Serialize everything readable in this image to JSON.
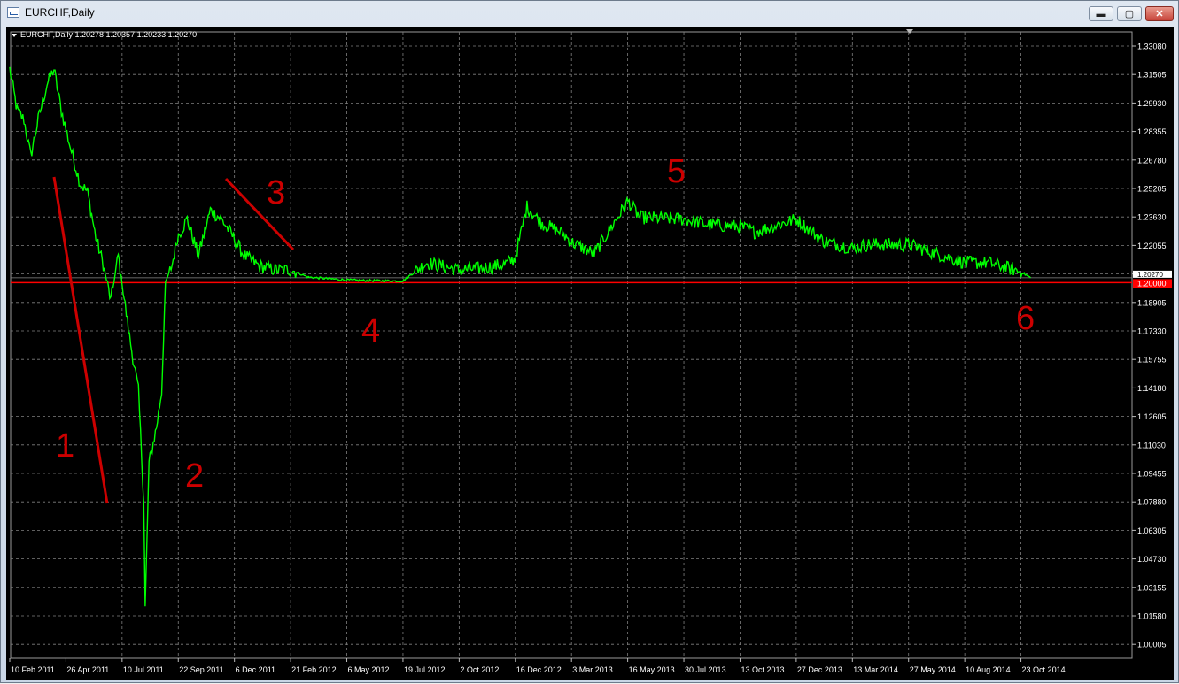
{
  "window": {
    "title": "EURCHF,Daily",
    "controls": {
      "minimize": "▬",
      "maximize": "▢",
      "close": "✕"
    }
  },
  "chart": {
    "info_line": "EURCHF,Daily  1.20278 1.20357 1.20233 1.20270",
    "price_scale": [
      "1.33080",
      "1.31505",
      "1.29930",
      "1.28355",
      "1.26780",
      "1.25205",
      "1.23630",
      "1.22055",
      "1.20270",
      "1.18905",
      "1.17330",
      "1.15755",
      "1.14180",
      "1.12605",
      "1.11030",
      "1.09455",
      "1.07880",
      "1.06305",
      "1.04730",
      "1.03155",
      "1.01580",
      "1.00005"
    ],
    "current_price_label": "1.20270",
    "level_label": "1.20000",
    "time_scale": [
      "10 Feb 2011",
      "26 Apr 2011",
      "10 Jul 2011",
      "22 Sep 2011",
      "6 Dec 2011",
      "21 Feb 2012",
      "6 May 2012",
      "19 Jul 2012",
      "2 Oct 2012",
      "16 Dec 2012",
      "3 Mar 2013",
      "16 May 2013",
      "30 Jul 2013",
      "13 Oct 2013",
      "27 Dec 2013",
      "13 Mar 2014",
      "27 May 2014",
      "10 Aug 2014",
      "23 Oct 2014"
    ],
    "annotations": [
      "1",
      "2",
      "3",
      "4",
      "5",
      "6"
    ],
    "colors": {
      "background": "#000000",
      "price_line": "#00ff00",
      "grid": "#7f7f7f",
      "level_line": "#ff0000",
      "annotation": "#cc0000",
      "text": "#ffffff"
    }
  },
  "chart_data": {
    "type": "line",
    "ylim": [
      1.00005,
      1.3308
    ],
    "level": 1.2,
    "series": [
      {
        "values": [
          [
            "10 Feb 2011",
            1.318
          ],
          [
            "20 Feb 2011",
            1.295
          ],
          [
            "1 Mar 2011",
            1.29
          ],
          [
            "10 Mar 2011",
            1.27
          ],
          [
            "20 Mar 2011",
            1.29
          ],
          [
            "1 Apr 2011",
            1.31
          ],
          [
            "10 Apr 2011",
            1.318
          ],
          [
            "20 Apr 2011",
            1.295
          ],
          [
            "26 Apr 2011",
            1.285
          ],
          [
            "5 May 2011",
            1.27
          ],
          [
            "15 May 2011",
            1.255
          ],
          [
            "25 May 2011",
            1.25
          ],
          [
            "5 Jun 2011",
            1.225
          ],
          [
            "15 Jun 2011",
            1.21
          ],
          [
            "25 Jun 2011",
            1.19
          ],
          [
            "5 Jul 2011",
            1.215
          ],
          [
            "10 Jul 2011",
            1.2
          ],
          [
            "20 Jul 2011",
            1.17
          ],
          [
            "1 Aug 2011",
            1.14
          ],
          [
            "8 Aug 2011",
            1.08
          ],
          [
            "10 Aug 2011",
            1.02
          ],
          [
            "15 Aug 2011",
            1.1
          ],
          [
            "25 Aug 2011",
            1.12
          ],
          [
            "1 Sep 2011",
            1.14
          ],
          [
            "6 Sep 2011",
            1.2
          ],
          [
            "15 Sep 2011",
            1.21
          ],
          [
            "22 Sep 2011",
            1.225
          ],
          [
            "5 Oct 2011",
            1.235
          ],
          [
            "20 Oct 2011",
            1.215
          ],
          [
            "5 Nov 2011",
            1.24
          ],
          [
            "20 Nov 2011",
            1.235
          ],
          [
            "6 Dec 2011",
            1.225
          ],
          [
            "20 Dec 2011",
            1.215
          ],
          [
            "10 Jan 2012",
            1.209
          ],
          [
            "1 Feb 2012",
            1.207
          ],
          [
            "21 Feb 2012",
            1.207
          ],
          [
            "15 Mar 2012",
            1.203
          ],
          [
            "6 May 2012",
            1.2015
          ],
          [
            "1 Jun 2012",
            1.2012
          ],
          [
            "19 Jul 2012",
            1.2009
          ],
          [
            "20 Aug 2012",
            1.211
          ],
          [
            "2 Oct 2012",
            1.207
          ],
          [
            "1 Nov 2012",
            1.208
          ],
          [
            "1 Dec 2012",
            1.21
          ],
          [
            "16 Dec 2012",
            1.213
          ],
          [
            "1 Jan 2013",
            1.242
          ],
          [
            "20 Jan 2013",
            1.233
          ],
          [
            "15 Feb 2013",
            1.228
          ],
          [
            "3 Mar 2013",
            1.222
          ],
          [
            "1 Apr 2013",
            1.216
          ],
          [
            "16 May 2013",
            1.245
          ],
          [
            "1 Jun 2013",
            1.236
          ],
          [
            "30 Jul 2013",
            1.235
          ],
          [
            "1 Sep 2013",
            1.232
          ],
          [
            "13 Oct 2013",
            1.231
          ],
          [
            "1 Nov 2013",
            1.228
          ],
          [
            "27 Dec 2013",
            1.235
          ],
          [
            "1 Feb 2014",
            1.223
          ],
          [
            "13 Mar 2014",
            1.219
          ],
          [
            "1 Apr 2014",
            1.221
          ],
          [
            "27 May 2014",
            1.221
          ],
          [
            "1 Jul 2014",
            1.216
          ],
          [
            "10 Aug 2014",
            1.211
          ],
          [
            "10 Sep 2014",
            1.211
          ],
          [
            "23 Oct 2014",
            1.206
          ],
          [
            "5 Nov 2014",
            1.2027
          ]
        ]
      }
    ]
  }
}
